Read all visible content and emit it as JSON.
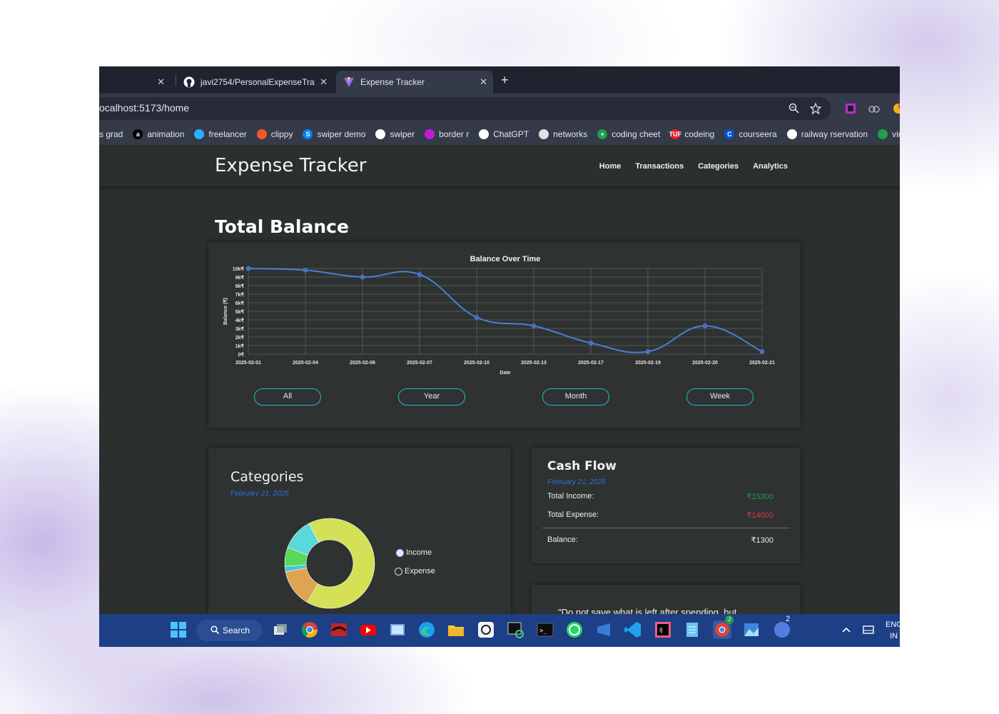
{
  "browser": {
    "tabs": [
      {
        "title": "",
        "icon": "partial-tab-icon"
      },
      {
        "title": "javi2754/PersonalExpenseTrack",
        "icon": "github-icon"
      },
      {
        "title": "Expense Tracker",
        "icon": "vite-icon"
      }
    ],
    "new_tab_label": "+",
    "close_glyph": "✕",
    "url": "ocalhost:5173/home",
    "bookmarks": [
      {
        "label": "s grad",
        "icon": "",
        "color": ""
      },
      {
        "label": "animation",
        "icon": "a",
        "color": "#000000"
      },
      {
        "label": "freelancer",
        "icon": "",
        "color": "#29b2fe"
      },
      {
        "label": "clippy",
        "icon": "",
        "color": "#f05a28"
      },
      {
        "label": "swiper demo",
        "icon": "S",
        "color": "#0080ff"
      },
      {
        "label": "swiper",
        "icon": "",
        "color": "#ffffff"
      },
      {
        "label": "border r",
        "icon": "",
        "color": "#c21bd6"
      },
      {
        "label": "ChatGPT",
        "icon": "",
        "color": "#ffffff"
      },
      {
        "label": "networks",
        "icon": "",
        "color": "#e0e0e0"
      },
      {
        "label": "coding cheet",
        "icon": "+",
        "color": "#1e9e4c"
      },
      {
        "label": "codeing",
        "icon": "TUF",
        "color": "#e32323"
      },
      {
        "label": "courseera",
        "icon": "C",
        "color": "#0056d2"
      },
      {
        "label": "railway rservation",
        "icon": "",
        "color": "#ffffff"
      },
      {
        "label": "virtu",
        "icon": "",
        "color": "#1ea04c"
      }
    ]
  },
  "app": {
    "title": "Expense Tracker",
    "nav": [
      "Home",
      "Transactions",
      "Categories",
      "Analytics"
    ],
    "section_title": "Total Balance",
    "range_buttons": [
      "All",
      "Year",
      "Month",
      "Week"
    ]
  },
  "chart_data": {
    "type": "line",
    "title": "Balance Over Time",
    "xlabel": "Date",
    "ylabel": "Balance (₹)",
    "x": [
      "2025-02-01",
      "2025-02-04",
      "2025-02-06",
      "2025-02-07",
      "2025-02-10",
      "2025-02-13",
      "2025-02-17",
      "2025-02-19",
      "2025-02-20",
      "2025-02-21"
    ],
    "series": [
      {
        "values": [
          10000,
          9800,
          9000,
          9300,
          4300,
          3300,
          1300,
          300,
          3300,
          300
        ]
      }
    ],
    "yticks": [
      "10k₹",
      "9k₹",
      "8k₹",
      "7k₹",
      "6k₹",
      "5k₹",
      "4k₹",
      "3k₹",
      "2k₹",
      "1k₹",
      "0₹"
    ],
    "ylim": [
      0,
      10000
    ],
    "grid": true,
    "line_color": "#4a7fd6"
  },
  "categories": {
    "title": "Categories",
    "date": "February 21, 2025",
    "legend": [
      {
        "label": "Income",
        "checked": true
      },
      {
        "label": "Expense",
        "checked": false
      }
    ],
    "donut": [
      {
        "value": 68,
        "color": "#d4e056"
      },
      {
        "value": 14,
        "color": "#e0a352"
      },
      {
        "value": 2,
        "color": "#3ec8d8"
      },
      {
        "value": 7,
        "color": "#58d85a"
      },
      {
        "value": 12,
        "color": "#5ad8dc"
      }
    ]
  },
  "cash_flow": {
    "title": "Cash Flow",
    "date": "February 21, 2025",
    "income_label": "Total Income:",
    "income_value": "₹15300",
    "expense_label": "Total Expense:",
    "expense_value": "₹14000",
    "balance_label": "Balance:",
    "balance_value": "₹1300",
    "income_color": "#1f9a4a",
    "expense_color": "#d83a3a"
  },
  "quote": {
    "text": "\"Do not save what is left after spending, but"
  },
  "taskbar": {
    "search_label": "Search",
    "lang_line1": "ENG",
    "lang_line2": "IN",
    "badge_j": "J",
    "badge_2": "2"
  }
}
